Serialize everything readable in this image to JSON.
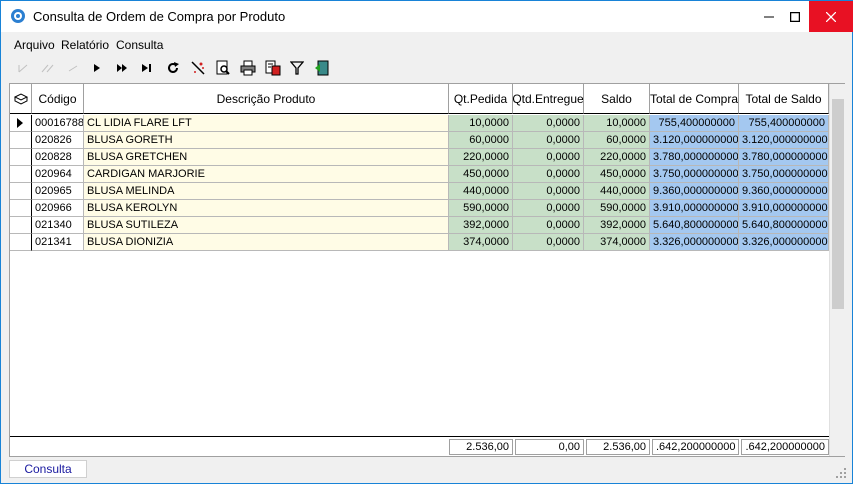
{
  "window": {
    "title": "Consulta de Ordem de Compra por Produto"
  },
  "menu": [
    {
      "label": "Arquivo"
    },
    {
      "label": "Relatório"
    },
    {
      "label": "Consulta"
    }
  ],
  "toolbar": [
    {
      "icon": "first-record-icon"
    },
    {
      "icon": "prior-page-icon"
    },
    {
      "icon": "prior-record-icon"
    },
    {
      "icon": "next-record-icon"
    },
    {
      "icon": "next-page-icon"
    },
    {
      "icon": "last-record-icon"
    },
    {
      "icon": "refresh-icon"
    },
    {
      "icon": "clear-icon"
    },
    {
      "icon": "preview-icon"
    },
    {
      "icon": "print-icon"
    },
    {
      "icon": "export-icon"
    },
    {
      "icon": "filter-icon"
    },
    {
      "icon": "exit-icon"
    }
  ],
  "grid": {
    "columns": [
      "Código",
      "Descrição Produto",
      "Qt.Pedida",
      "Qtd.Entregue",
      "Saldo",
      "Total de Compra",
      "Total de Saldo"
    ],
    "rows": [
      [
        "00016788",
        "CL LIDIA FLARE LFT",
        "10,0000",
        "0,0000",
        "10,0000",
        "755,400000000",
        "755,400000000"
      ],
      [
        "020826",
        "BLUSA GORETH",
        "60,0000",
        "0,0000",
        "60,0000",
        "3.120,000000000",
        "3.120,000000000"
      ],
      [
        "020828",
        "BLUSA GRETCHEN",
        "220,0000",
        "0,0000",
        "220,0000",
        "3.780,000000000",
        "3.780,000000000"
      ],
      [
        "020964",
        "CARDIGAN MARJORIE",
        "450,0000",
        "0,0000",
        "450,0000",
        "3.750,000000000",
        "3.750,000000000"
      ],
      [
        "020965",
        "BLUSA MELINDA",
        "440,0000",
        "0,0000",
        "440,0000",
        "9.360,000000000",
        "9.360,000000000"
      ],
      [
        "020966",
        "BLUSA KEROLYN",
        "590,0000",
        "0,0000",
        "590,0000",
        "3.910,000000000",
        "3.910,000000000"
      ],
      [
        "021340",
        "BLUSA SUTILEZA",
        "392,0000",
        "0,0000",
        "392,0000",
        "5.640,800000000",
        "5.640,800000000"
      ],
      [
        "021341",
        "BLUSA DIONIZIA",
        "374,0000",
        "0,0000",
        "374,0000",
        "3.326,000000000",
        "3.326,000000000"
      ]
    ],
    "totals": [
      "2.536,00",
      "0,00",
      "2.536,00",
      ".642,200000000",
      ".642,200000000"
    ]
  },
  "statusbar": {
    "tab_label": "Consulta"
  },
  "colors": {
    "text_cell": "#fffce6",
    "num_cell": "#c8e0c8",
    "total_cell": "#a4c8f0",
    "close_button": "#e81123"
  }
}
